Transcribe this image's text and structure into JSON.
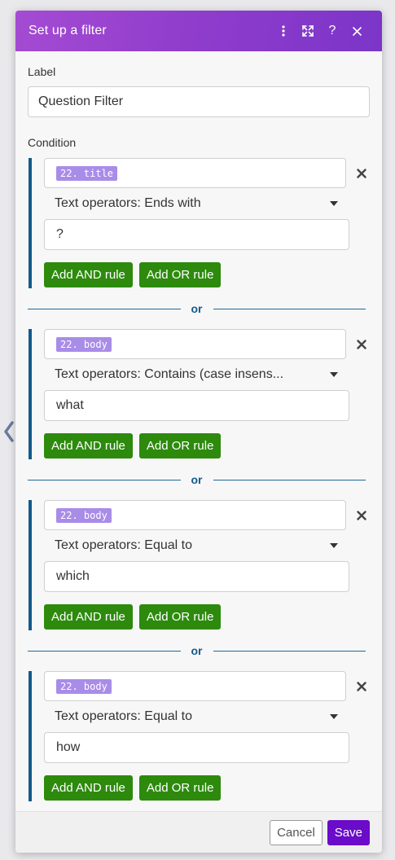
{
  "header": {
    "title": "Set up a filter",
    "icons": [
      "more-vertical-icon",
      "expand-icon",
      "help-icon",
      "close-icon"
    ],
    "help_glyph": "?",
    "gradient_colors": [
      "#a44bd3",
      "#7b35c8"
    ]
  },
  "label_field": {
    "label": "Label",
    "value": "Question Filter"
  },
  "condition": {
    "label": "Condition",
    "or_label": "or",
    "rules": [
      {
        "token": "22. title",
        "operator": "Text operators: Ends with",
        "value": "?",
        "and_label": "Add AND rule",
        "or_label": "Add OR rule"
      },
      {
        "token": "22. body",
        "operator": "Text operators: Contains (case insens...",
        "value": "what",
        "and_label": "Add AND rule",
        "or_label": "Add OR rule"
      },
      {
        "token": "22. body",
        "operator": "Text operators: Equal to",
        "value": "which",
        "and_label": "Add AND rule",
        "or_label": "Add OR rule"
      },
      {
        "token": "22. body",
        "operator": "Text operators: Equal to",
        "value": "how",
        "and_label": "Add AND rule",
        "or_label": "Add OR rule"
      }
    ]
  },
  "footer": {
    "cancel_label": "Cancel",
    "save_label": "Save"
  },
  "colors": {
    "accent_purple": "#6a0cc9",
    "rule_blue": "#135a8c",
    "add_green": "#2d8a0d",
    "token_purple": "#a98ce8"
  }
}
